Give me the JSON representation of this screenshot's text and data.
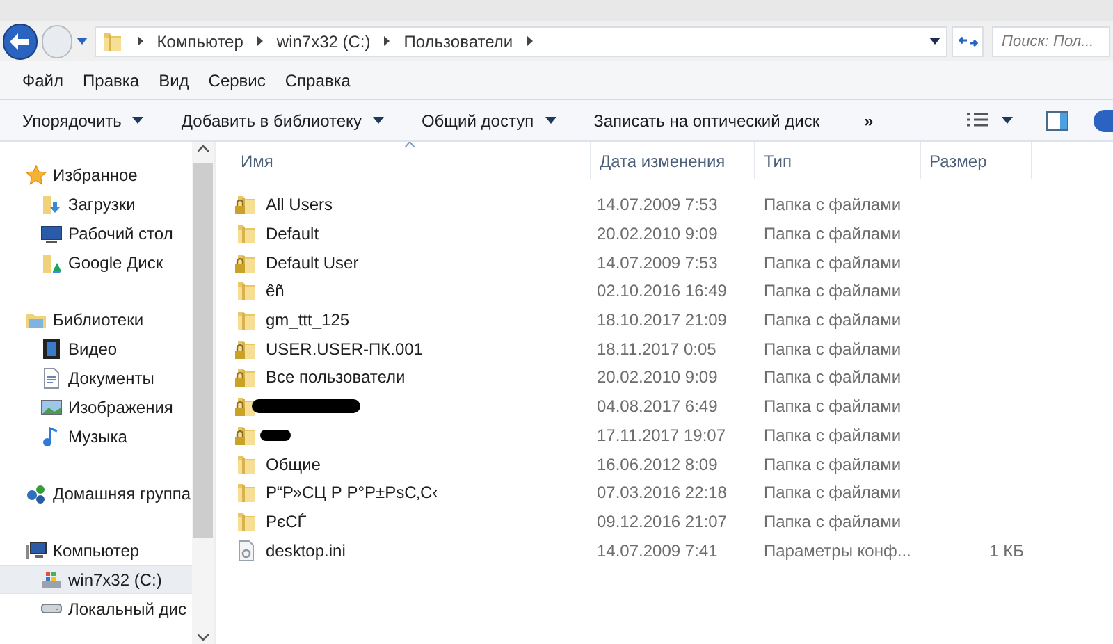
{
  "address_bar": {
    "crumbs": [
      "Компьютер",
      "win7x32 (C:)",
      "Пользователи"
    ],
    "search": {
      "placeholder": "Поиск: Пол..."
    }
  },
  "menu": [
    "Файл",
    "Правка",
    "Вид",
    "Сервис",
    "Справка"
  ],
  "toolbar": [
    "Упорядочить",
    "Добавить в библиотеку",
    "Общий доступ",
    "Записать на оптический диск"
  ],
  "toolbar_more": "»",
  "sidebar": {
    "groups": [
      {
        "label": "Избранное",
        "items": [
          {
            "label": "Загрузки",
            "selected": false
          },
          {
            "label": "Рабочий стол",
            "selected": false
          },
          {
            "label": "Google Диск",
            "selected": false
          }
        ]
      },
      {
        "label": "Библиотеки",
        "items": [
          {
            "label": "Видео",
            "selected": false
          },
          {
            "label": "Документы",
            "selected": false
          },
          {
            "label": "Изображения",
            "selected": false
          },
          {
            "label": "Музыка",
            "selected": false
          }
        ]
      },
      {
        "label": "Домашняя группа"
      },
      {
        "label": "Компьютер",
        "items": [
          {
            "label": "win7x32 (C:)",
            "selected": true
          },
          {
            "label": "Локальный дис",
            "selected": false
          }
        ]
      }
    ]
  },
  "table": {
    "columns": [
      "Имя",
      "Дата изменения",
      "Тип",
      "Размер"
    ],
    "rows": [
      {
        "kind": "folder",
        "locked": true,
        "name": "All Users",
        "date": "14.07.2009 7:53",
        "type": "Папка с файлами"
      },
      {
        "kind": "folder",
        "locked": false,
        "name": "Default",
        "date": "20.02.2010 9:09",
        "type": "Папка с файлами"
      },
      {
        "kind": "folder",
        "locked": true,
        "name": "Default User",
        "date": "14.07.2009 7:53",
        "type": "Папка с файлами"
      },
      {
        "kind": "folder",
        "locked": false,
        "name": "êñ",
        "date": "02.10.2016 16:49",
        "type": "Папка с файлами"
      },
      {
        "kind": "folder",
        "locked": false,
        "name": "gm_ttt_125",
        "date": "18.10.2017 21:09",
        "type": "Папка с файлами"
      },
      {
        "kind": "folder",
        "locked": true,
        "name": "USER.USER-ПК.001",
        "date": "18.11.2017 0:05",
        "type": "Папка с файлами"
      },
      {
        "kind": "folder",
        "locked": true,
        "name": "Все пользователи",
        "date": "20.02.2010 9:09",
        "type": "Папка с файлами"
      },
      {
        "kind": "folder",
        "locked": true,
        "date": "04.08.2017 6:49",
        "type": "Папка с файлами"
      },
      {
        "kind": "folder",
        "locked": true,
        "date": "17.11.2017 19:07",
        "type": "Папка с файлами"
      },
      {
        "kind": "folder",
        "locked": false,
        "name": "Общие",
        "date": "16.06.2012 8:09",
        "type": "Папка с файлами"
      },
      {
        "kind": "folder",
        "locked": false,
        "name": "Р“Р»СЦ Р Р°Р±РѕС‚С‹",
        "date": "07.03.2016 22:18",
        "type": "Папка с файлами"
      },
      {
        "kind": "folder",
        "locked": false,
        "name": "РєСЃ",
        "date": "09.12.2016 21:07",
        "type": "Папка с файлами"
      },
      {
        "kind": "file",
        "name": "desktop.ini",
        "date": "14.07.2009 7:41",
        "type": "Параметры конф...",
        "size": "1 КБ"
      }
    ]
  }
}
